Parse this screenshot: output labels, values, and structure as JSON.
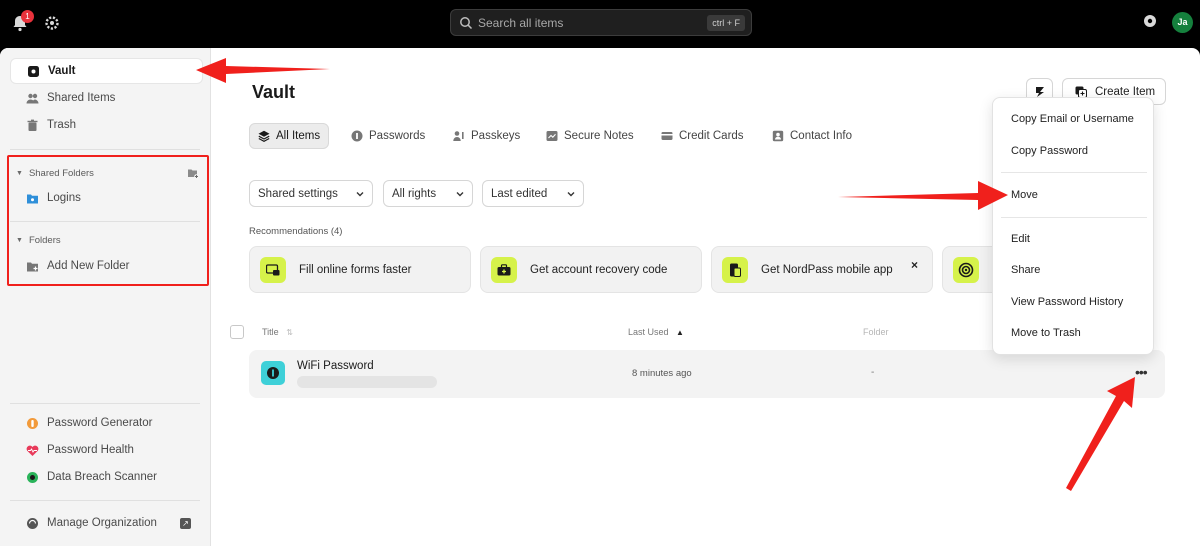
{
  "topbar": {
    "notification_count": "1",
    "search_placeholder": "Search all items",
    "search_shortcut": "ctrl + F",
    "user_initials": "Ja"
  },
  "sidebar": {
    "nav": [
      {
        "label": "Vault",
        "icon": "vault-icon"
      },
      {
        "label": "Shared Items",
        "icon": "users-icon"
      },
      {
        "label": "Trash",
        "icon": "trash-icon"
      }
    ],
    "shared_folders_heading": "Shared Folders",
    "shared_folders": [
      {
        "label": "Logins",
        "icon": "shared-folder-icon"
      }
    ],
    "folders_heading": "Folders",
    "add_folder_label": "Add New Folder",
    "tools": [
      {
        "label": "Password Generator",
        "icon": "password-generator-icon"
      },
      {
        "label": "Password Health",
        "icon": "heart-pulse-icon"
      },
      {
        "label": "Data Breach Scanner",
        "icon": "scanner-icon"
      }
    ],
    "manage_org_label": "Manage Organization"
  },
  "main": {
    "title": "Vault",
    "tabs": [
      {
        "label": "All Items",
        "icon": "layers-icon"
      },
      {
        "label": "Passwords",
        "icon": "key-icon"
      },
      {
        "label": "Passkeys",
        "icon": "passkey-icon"
      },
      {
        "label": "Secure Notes",
        "icon": "note-icon"
      },
      {
        "label": "Credit Cards",
        "icon": "credit-card-icon"
      },
      {
        "label": "Contact Info",
        "icon": "contact-icon"
      }
    ],
    "filters": [
      "Shared settings",
      "All rights",
      "Last edited"
    ],
    "recommendations_title": "Recommendations (4)",
    "recommendations": [
      "Fill online forms faster",
      "Get account recovery code",
      "Get NordPass mobile app",
      ""
    ],
    "close_glyph": "×",
    "columns": {
      "title": "Title",
      "last_used": "Last Used",
      "folder": "Folder"
    },
    "rows": [
      {
        "title": "WiFi Password",
        "last_used": "8 minutes ago",
        "folder": "-"
      }
    ],
    "create_item_label": "Create Item"
  },
  "context_menu": {
    "items": [
      "Copy Email or Username",
      "Copy Password",
      "Move",
      "Edit",
      "Share",
      "View Password History",
      "Move to Trash"
    ]
  },
  "colors": {
    "accent_lime": "#d6f24a",
    "annotation_red": "#f0201c",
    "avatar_green": "#15803d",
    "row_icon_teal": "#3ed0d8"
  }
}
